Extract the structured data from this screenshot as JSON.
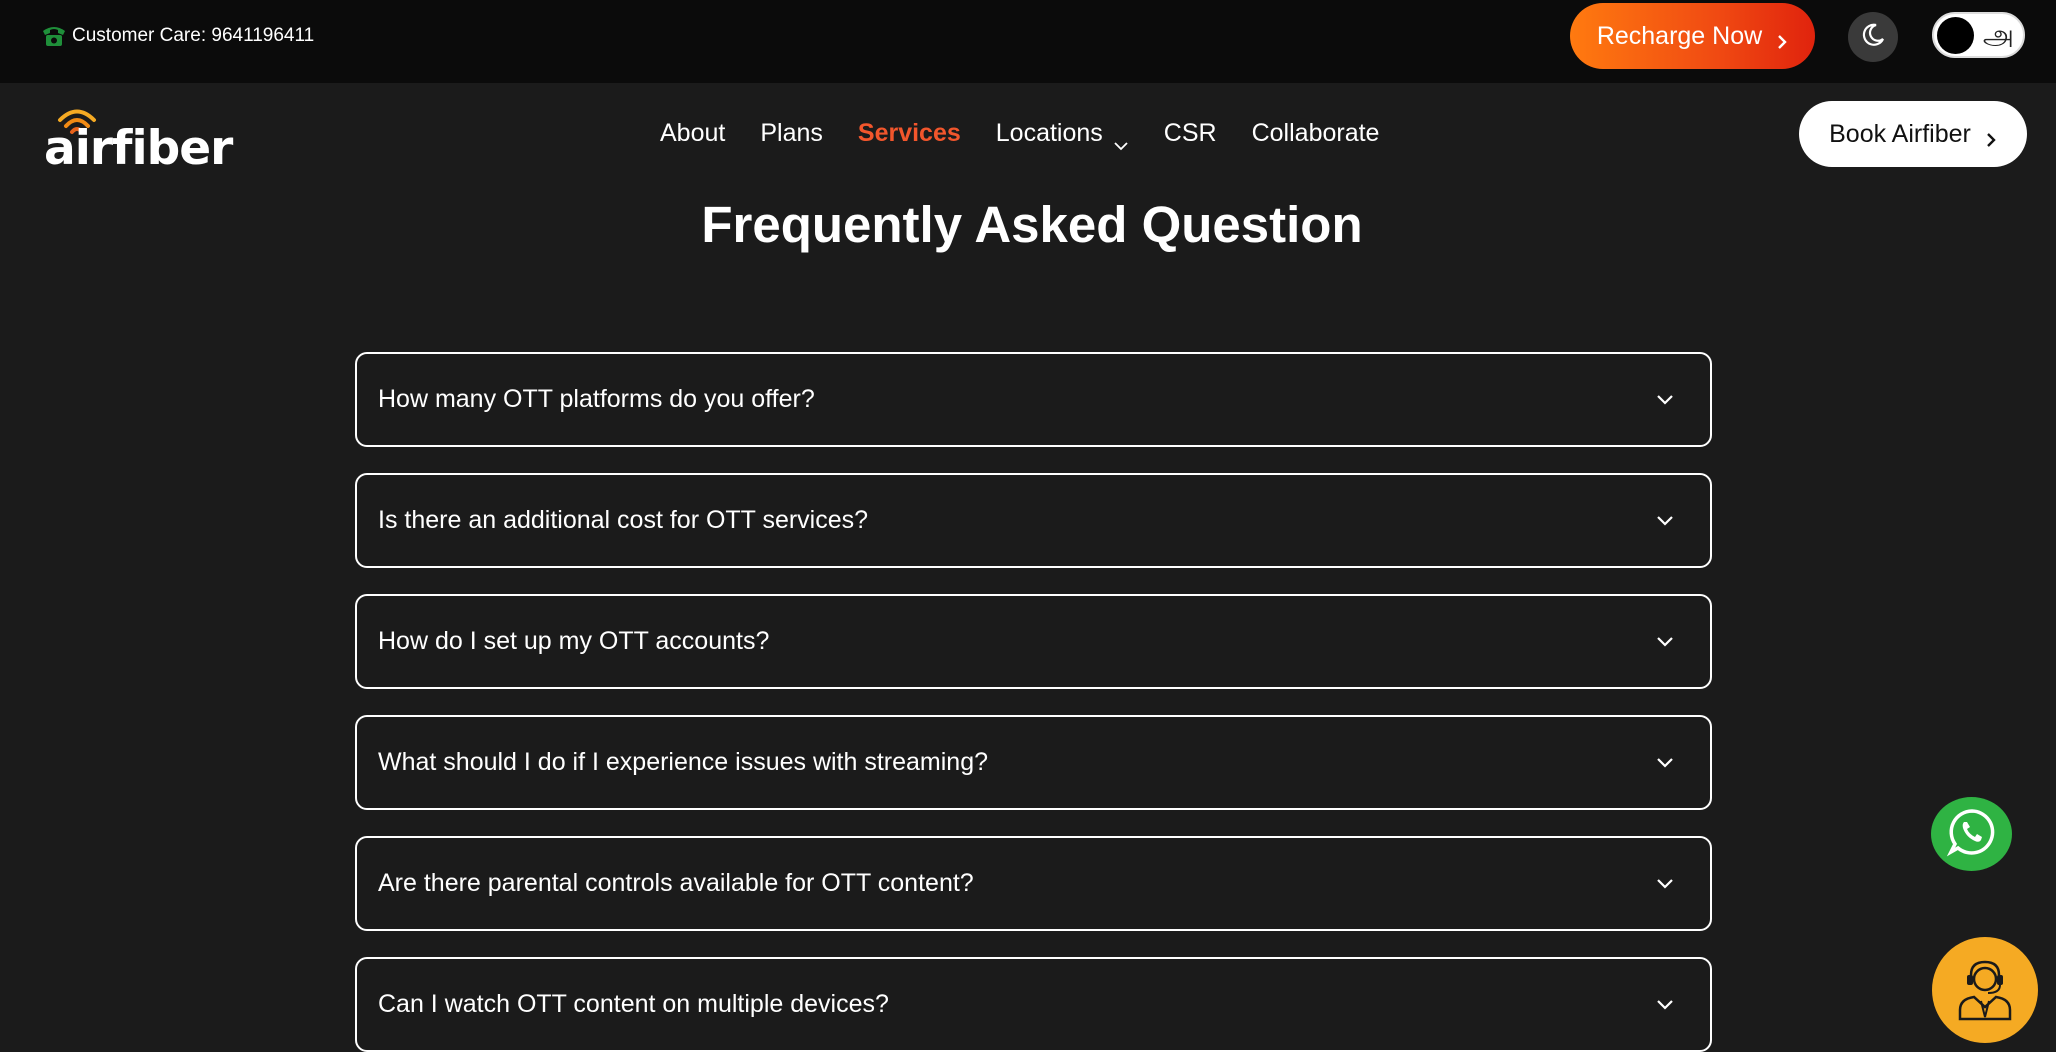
{
  "topbar": {
    "customer_care": "Customer Care: 9641196411",
    "phone_icon": "phone-icon",
    "recharge_label": "Recharge Now",
    "dark_mode_icon": "moon-icon",
    "language_toggle_char": "அ"
  },
  "nav": {
    "logo_text": "airfiber",
    "items": [
      {
        "label": "About",
        "active": false
      },
      {
        "label": "Plans",
        "active": false
      },
      {
        "label": "Services",
        "active": true
      },
      {
        "label": "Locations",
        "active": false,
        "dropdown": true
      },
      {
        "label": "CSR",
        "active": false
      },
      {
        "label": "Collaborate",
        "active": false
      }
    ],
    "book_label": "Book Airfiber"
  },
  "faq": {
    "title": "Frequently Asked Question",
    "questions": [
      "How many OTT platforms do you offer?",
      "Is there an additional cost for OTT services?",
      "How do I set up my OTT accounts?",
      "What should I do if I experience issues with streaming?",
      "Are there parental controls available for OTT content?",
      "Can I watch OTT content on multiple devices?"
    ]
  },
  "floating": {
    "whatsapp_icon": "whatsapp-icon",
    "support_icon": "customer-support-icon"
  },
  "colors": {
    "background": "#1b1b1b",
    "topbar": "#0b0b0b",
    "accent_orange": "#f2562c",
    "recharge_gradient_start": "#ff7a10",
    "recharge_gradient_end": "#e0230d",
    "whatsapp_green": "#2fb343",
    "support_yellow": "#f5aa23",
    "phone_green": "#1f8f3a"
  }
}
